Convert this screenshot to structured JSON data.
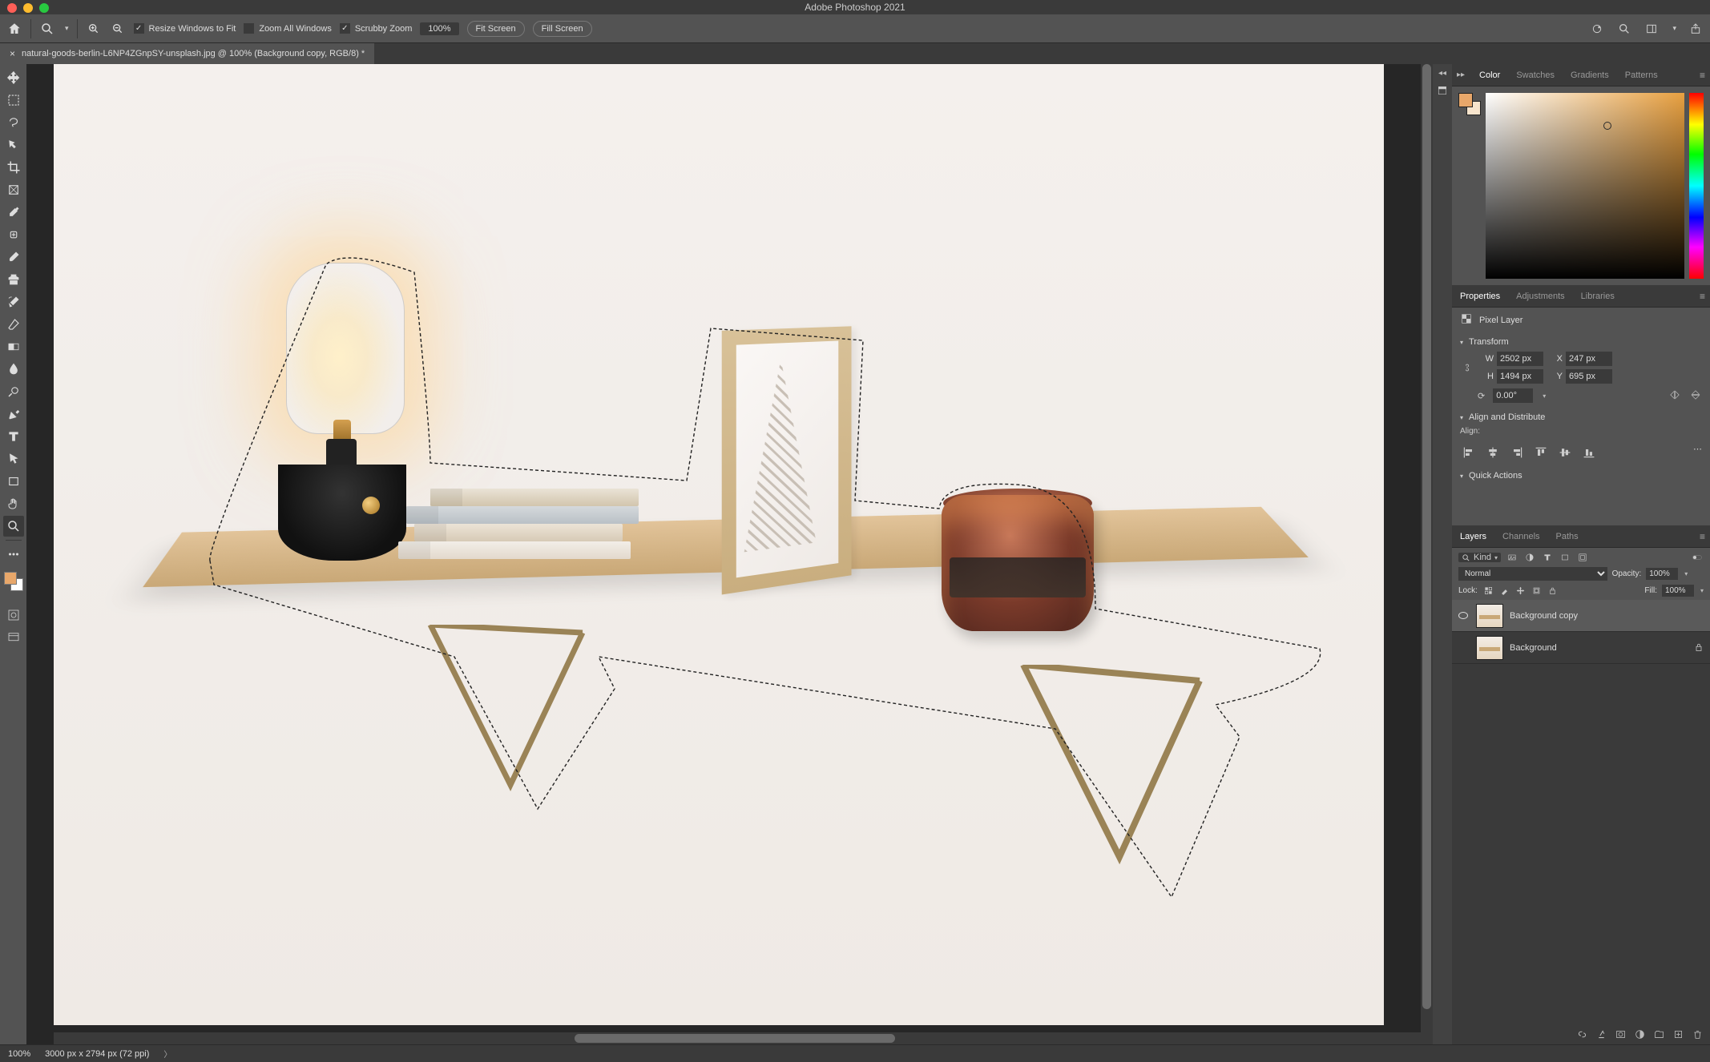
{
  "app_title": "Adobe Photoshop 2021",
  "options_bar": {
    "resize_windows": "Resize Windows to Fit",
    "zoom_all": "Zoom All Windows",
    "scrubby_zoom": "Scrubby Zoom",
    "zoom_percent": "100%",
    "fit_screen": "Fit Screen",
    "fill_screen": "Fill Screen"
  },
  "document_tab": {
    "label": "natural-goods-berlin-L6NP4ZGnpSY-unsplash.jpg @ 100% (Background copy, RGB/8) *"
  },
  "tools": [
    "move-tool",
    "marquee-tool",
    "lasso-tool",
    "quick-select-tool",
    "crop-tool",
    "frame-tool",
    "eyedropper-tool",
    "spot-heal-tool",
    "brush-tool",
    "clone-tool",
    "history-brush-tool",
    "eraser-tool",
    "gradient-tool",
    "blur-tool",
    "dodge-tool",
    "pen-tool",
    "type-tool",
    "path-select-tool",
    "rectangle-tool",
    "hand-tool",
    "zoom-tool"
  ],
  "color_panel": {
    "tabs": [
      "Color",
      "Swatches",
      "Gradients",
      "Patterns"
    ]
  },
  "properties_panel": {
    "tabs": [
      "Properties",
      "Adjustments",
      "Libraries"
    ],
    "header": "Pixel Layer",
    "sections": {
      "transform": "Transform",
      "align": "Align and Distribute",
      "align_sub": "Align:",
      "quick": "Quick Actions"
    },
    "transform": {
      "W": "2502 px",
      "H": "1494 px",
      "X": "247 px",
      "Y": "695 px",
      "angle": "0.00°"
    }
  },
  "layers_panel": {
    "tabs": [
      "Layers",
      "Channels",
      "Paths"
    ],
    "filter_kind": "Kind",
    "blend_mode": "Normal",
    "opacity_label": "Opacity:",
    "opacity_value": "100%",
    "lock_label": "Lock:",
    "fill_label": "Fill:",
    "fill_value": "100%",
    "layers": [
      {
        "name": "Background copy",
        "visible": true,
        "locked": false,
        "active": true
      },
      {
        "name": "Background",
        "visible": true,
        "locked": true,
        "active": false
      }
    ]
  },
  "status_bar": {
    "zoom": "100%",
    "doc_info": "3000 px x 2794 px (72 ppi)"
  },
  "colors": {
    "foreground": "#e8a76a",
    "background": "#ffffff"
  }
}
